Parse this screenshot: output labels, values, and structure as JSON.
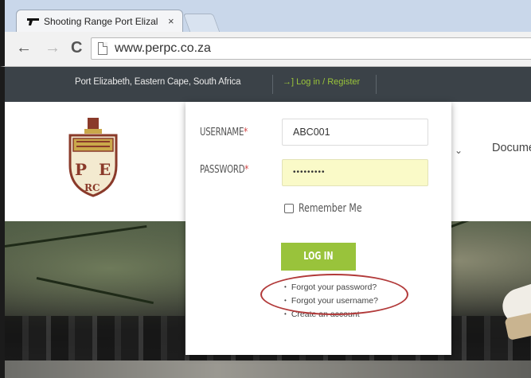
{
  "browser": {
    "tab_title": "Shooting Range Port Elizal",
    "tab_close": "×",
    "nav": {
      "back": "←",
      "forward": "→",
      "reload": "C"
    },
    "url": "www.perpc.co.za"
  },
  "site": {
    "topbar": {
      "location": "Port Elizabeth, Eastern Cape, South Africa",
      "login_link": "Log in / Register",
      "login_icon": "→]"
    },
    "header": {
      "crest_letters": {
        "left": "P",
        "right": "E",
        "bottom": "RC"
      },
      "nav_chevron": "⌄",
      "nav_item": "Documen"
    }
  },
  "login_form": {
    "username_label": "USERNAME",
    "password_label": "PASSWORD",
    "required_mark": "*",
    "username_value": "ABC001",
    "password_value": "•••••••••",
    "remember_label": "Remember Me",
    "remember_checked": false,
    "login_button": "LOG IN",
    "links": [
      "Forgot your password?",
      "Forgot your username?",
      "Create an account"
    ]
  },
  "colors": {
    "accent_green": "#99c33b",
    "topbar_bg": "#3b4248",
    "annotation_red": "#b23a3a"
  }
}
